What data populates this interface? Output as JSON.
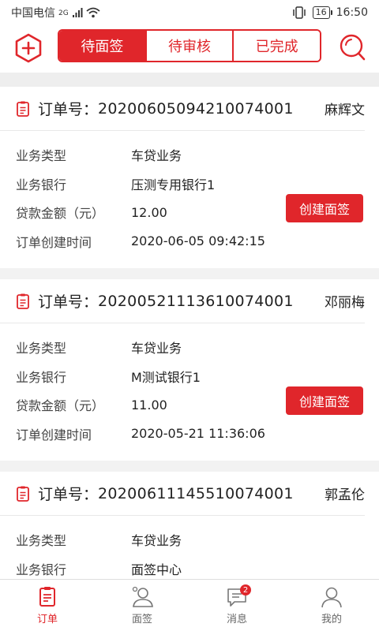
{
  "status_bar": {
    "carrier": "中国电信",
    "network": "2G",
    "battery": "16",
    "time": "16:50"
  },
  "tabs": [
    {
      "label": "待面签",
      "active": true
    },
    {
      "label": "待审核",
      "active": false
    },
    {
      "label": "已完成",
      "active": false
    }
  ],
  "card_labels": {
    "order_label": "订单号：",
    "business_type": "业务类型",
    "bank": "业务银行",
    "amount": "贷款金额（元）",
    "created_time": "订单创建时间",
    "create_button": "创建面签"
  },
  "orders": [
    {
      "order_no": "20200605094210074001",
      "customer": "麻辉文",
      "business_type": "车贷业务",
      "bank": "压测专用银行1",
      "amount": "12.00",
      "created_time": "2020-06-05 09:42:15"
    },
    {
      "order_no": "20200521113610074001",
      "customer": "邓丽梅",
      "business_type": "车贷业务",
      "bank": "M测试银行1",
      "amount": "11.00",
      "created_time": "2020-05-21 11:36:06"
    },
    {
      "order_no": "20200611145510074001",
      "customer": "郭孟伦",
      "business_type": "车贷业务",
      "bank": "面签中心",
      "amount": "",
      "created_time": ""
    }
  ],
  "bottom_nav": [
    {
      "label": "订单",
      "icon": "order-icon",
      "active": true
    },
    {
      "label": "面签",
      "icon": "interview-icon",
      "active": false
    },
    {
      "label": "消息",
      "icon": "message-icon",
      "active": false,
      "badge": "2"
    },
    {
      "label": "我的",
      "icon": "profile-icon",
      "active": false
    }
  ],
  "colors": {
    "accent": "#e0262b",
    "background": "#f2f2f2"
  }
}
